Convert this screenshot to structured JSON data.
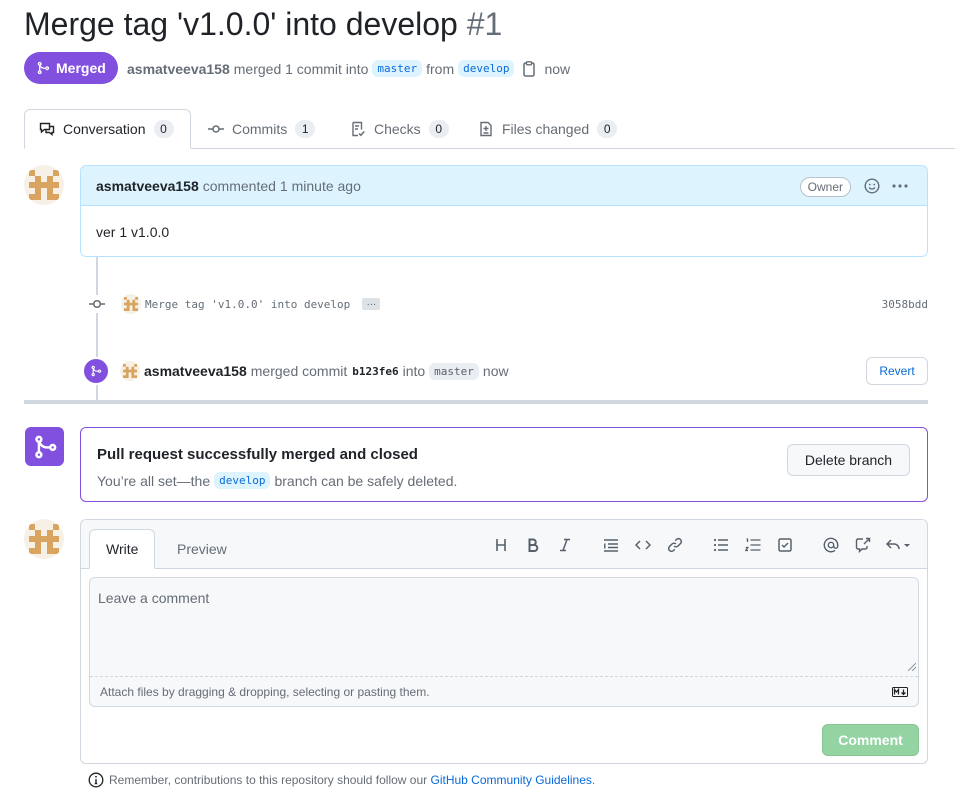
{
  "header": {
    "title": "Merge tag 'v1.0.0' into develop",
    "number": "#1",
    "state": "Merged",
    "author": "asmatveeva158",
    "merged_text": "merged 1 commit into",
    "base_branch": "master",
    "from_text": "from",
    "head_branch": "develop",
    "time": "now"
  },
  "tabs": [
    {
      "label": "Conversation",
      "count": "0",
      "icon": "comment-discussion-icon"
    },
    {
      "label": "Commits",
      "count": "1",
      "icon": "git-commit-icon"
    },
    {
      "label": "Checks",
      "count": "0",
      "icon": "checklist-icon"
    },
    {
      "label": "Files changed",
      "count": "0",
      "icon": "file-diff-icon"
    }
  ],
  "comment": {
    "author": "asmatveeva158",
    "action": "commented",
    "time": "1 minute ago",
    "role": "Owner",
    "body": "ver 1 v1.0.0"
  },
  "commit": {
    "message": "Merge tag 'v1.0.0' into develop",
    "ellipsis": "…",
    "sha": "3058bdd"
  },
  "merge_event": {
    "author": "asmatveeva158",
    "action": "merged commit",
    "sha": "b123fe6",
    "into": "into",
    "branch": "master",
    "time": "now",
    "revert_label": "Revert"
  },
  "merge_box": {
    "title": "Pull request successfully merged and closed",
    "sub_before": "You’re all set—the",
    "branch": "develop",
    "sub_after": "branch can be safely deleted.",
    "delete_label": "Delete branch"
  },
  "editor": {
    "tab_write": "Write",
    "tab_preview": "Preview",
    "placeholder": "Leave a comment",
    "attach_text": "Attach files by dragging & dropping, selecting or pasting them.",
    "comment_label": "Comment",
    "toolbar": [
      "heading-icon",
      "bold-icon",
      "italic-icon",
      "quote-icon",
      "code-icon",
      "link-icon",
      "unordered-list-icon",
      "ordered-list-icon",
      "tasklist-icon",
      "mention-icon",
      "cross-reference-icon",
      "reply-icon"
    ]
  },
  "footer": {
    "text": "Remember, contributions to this repository should follow our",
    "link": "GitHub Community Guidelines",
    "end": "."
  },
  "colors": {
    "merged": "#8250df",
    "link": "#0969da",
    "comment_btn": "#94d3a2"
  }
}
